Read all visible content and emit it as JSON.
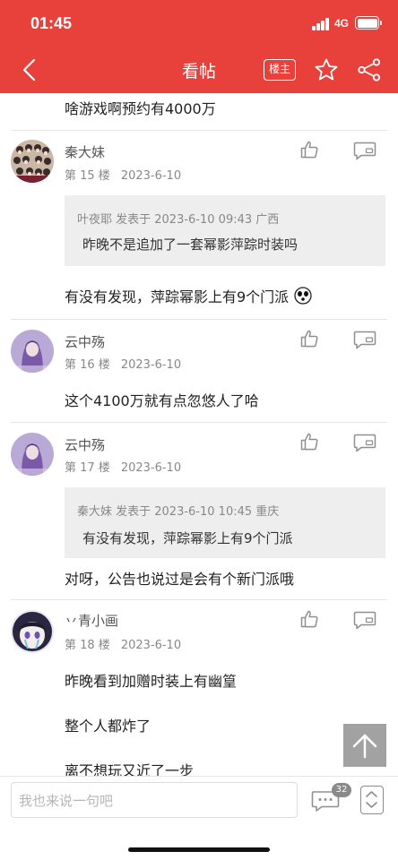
{
  "status": {
    "time": "01:45",
    "network": "4G"
  },
  "nav": {
    "title": "看帖",
    "owner_badge": "楼主"
  },
  "prev_post_tail": "啥游戏啊预约有4000万",
  "posts": [
    {
      "username": "秦大妹",
      "floor": "第 15 楼",
      "date": "2023-6-10",
      "quote": {
        "header": "叶夜耶 发表于 2023-6-10 09:43 广西",
        "text": "昨晚不是追加了一套幂影萍踪时装吗"
      },
      "lines": [
        "有没有发现，萍踪幂影上有9个门派"
      ]
    },
    {
      "username": "云中殇",
      "floor": "第 16 楼",
      "date": "2023-6-10",
      "lines": [
        "这个4100万就有点忽悠人了哈"
      ]
    },
    {
      "username": "云中殇",
      "floor": "第 17 楼",
      "date": "2023-6-10",
      "quote": {
        "header": "秦大妹 发表于 2023-6-10 10:45 重庆",
        "text": "有没有发现，萍踪幂影上有9个门派"
      },
      "lines": [
        "对呀，公告也说过是会有个新门派哦"
      ]
    },
    {
      "username": "丷青小画",
      "floor": "第 18 楼",
      "date": "2023-6-10",
      "lines": [
        "昨晚看到加赠时装上有幽篁",
        "整个人都炸了",
        "离不想玩又近了一步"
      ]
    }
  ],
  "bottom": {
    "placeholder": "我也来说一句吧",
    "comment_count": "32"
  },
  "colors": {
    "brand_red": "#e8403a",
    "quote_bg": "#eeeeee"
  },
  "icons": [
    "back-icon",
    "star-icon",
    "share-icon",
    "like-icon",
    "reply-icon",
    "scroll-top-icon",
    "comment-icon",
    "page-nav-icon"
  ]
}
